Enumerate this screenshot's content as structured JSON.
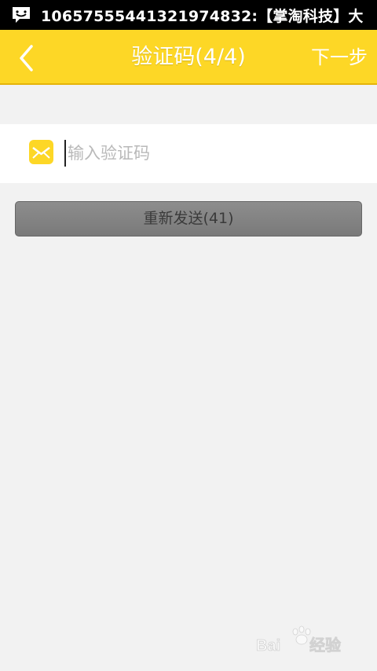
{
  "status_bar": {
    "notification_text": "10657555441321974832:【掌淘科技】大",
    "icon": "sms-message-icon"
  },
  "app_bar": {
    "title": "验证码(4/4)",
    "next_label": "下一步",
    "back_icon": "chevron-left-icon"
  },
  "verification": {
    "placeholder": "输入验证码",
    "value": "",
    "icon": "envelope-icon"
  },
  "resend": {
    "label": "重新发送(41)"
  },
  "colors": {
    "accent": "#fdd726",
    "background": "#f2f2f2",
    "button": "#828282"
  }
}
